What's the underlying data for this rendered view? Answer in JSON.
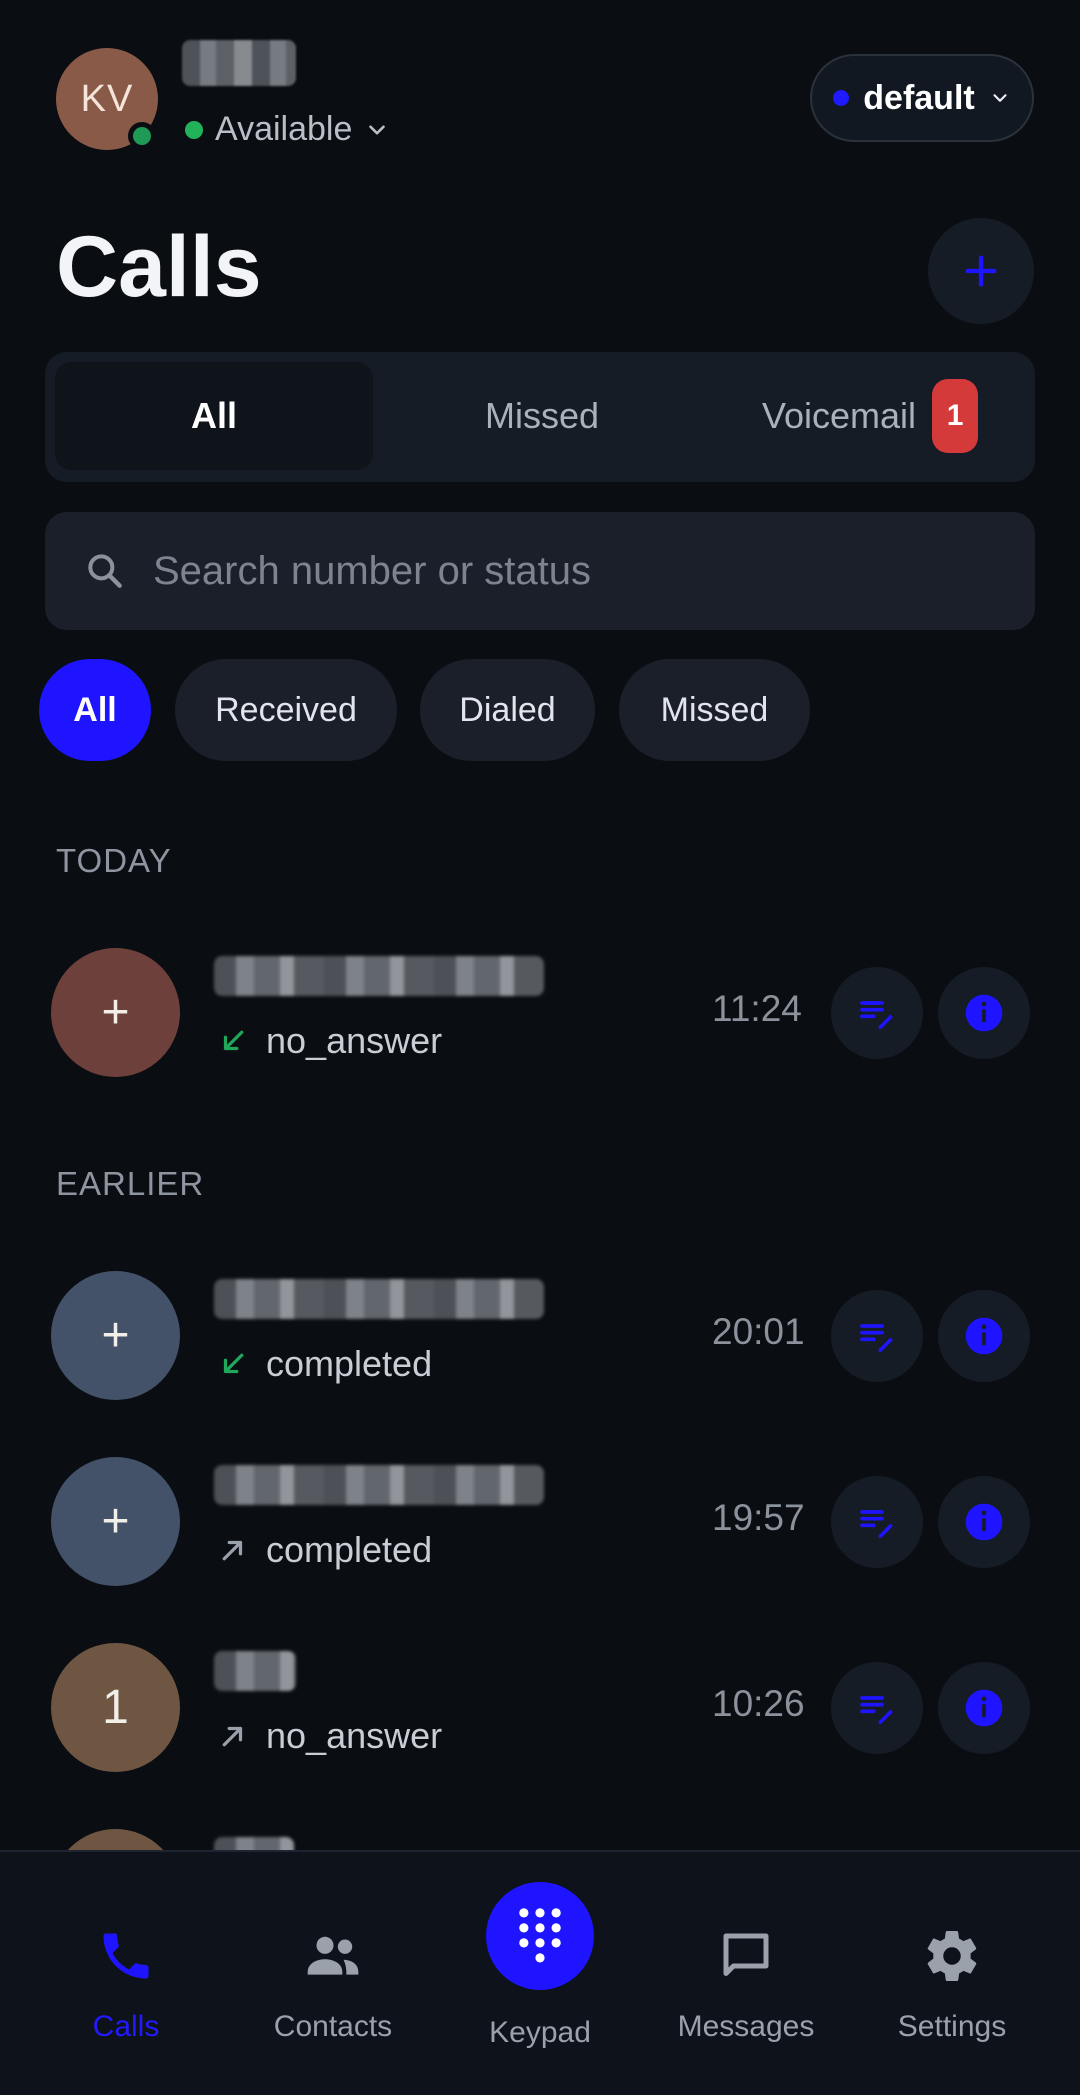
{
  "header": {
    "avatar_initials": "KV",
    "presence": "Available",
    "profile": "default"
  },
  "title": "Calls",
  "tabs": [
    {
      "label": "All",
      "active": true
    },
    {
      "label": "Missed",
      "active": false
    },
    {
      "label": "Voicemail",
      "active": false,
      "badge": "1"
    }
  ],
  "search": {
    "placeholder": "Search number or status",
    "value": ""
  },
  "filters": [
    {
      "label": "All",
      "active": true
    },
    {
      "label": "Received",
      "active": false
    },
    {
      "label": "Dialed",
      "active": false
    },
    {
      "label": "Missed",
      "active": false
    }
  ],
  "sections": {
    "today": "TODAY",
    "earlier": "EARLIER"
  },
  "calls": [
    {
      "avatar": "+",
      "status": "no_answer",
      "direction": "incoming",
      "time": "11:24",
      "avatar_color": "#6e403b"
    },
    {
      "avatar": "+",
      "status": "completed",
      "direction": "incoming",
      "time": "20:01",
      "avatar_color": "#435169"
    },
    {
      "avatar": "+",
      "status": "completed",
      "direction": "outgoing",
      "time": "19:57",
      "avatar_color": "#435169"
    },
    {
      "avatar": "1",
      "status": "no_answer",
      "direction": "outgoing",
      "time": "10:26",
      "avatar_color": "#6e5642"
    }
  ],
  "nav": {
    "calls": "Calls",
    "contacts": "Contacts",
    "keypad": "Keypad",
    "messages": "Messages",
    "settings": "Settings"
  },
  "colors": {
    "accent": "#1f14ff",
    "background": "#0a0d12",
    "badge": "#d43a3a",
    "incoming_arrow": "#1fa85a",
    "available": "#22b35a"
  }
}
